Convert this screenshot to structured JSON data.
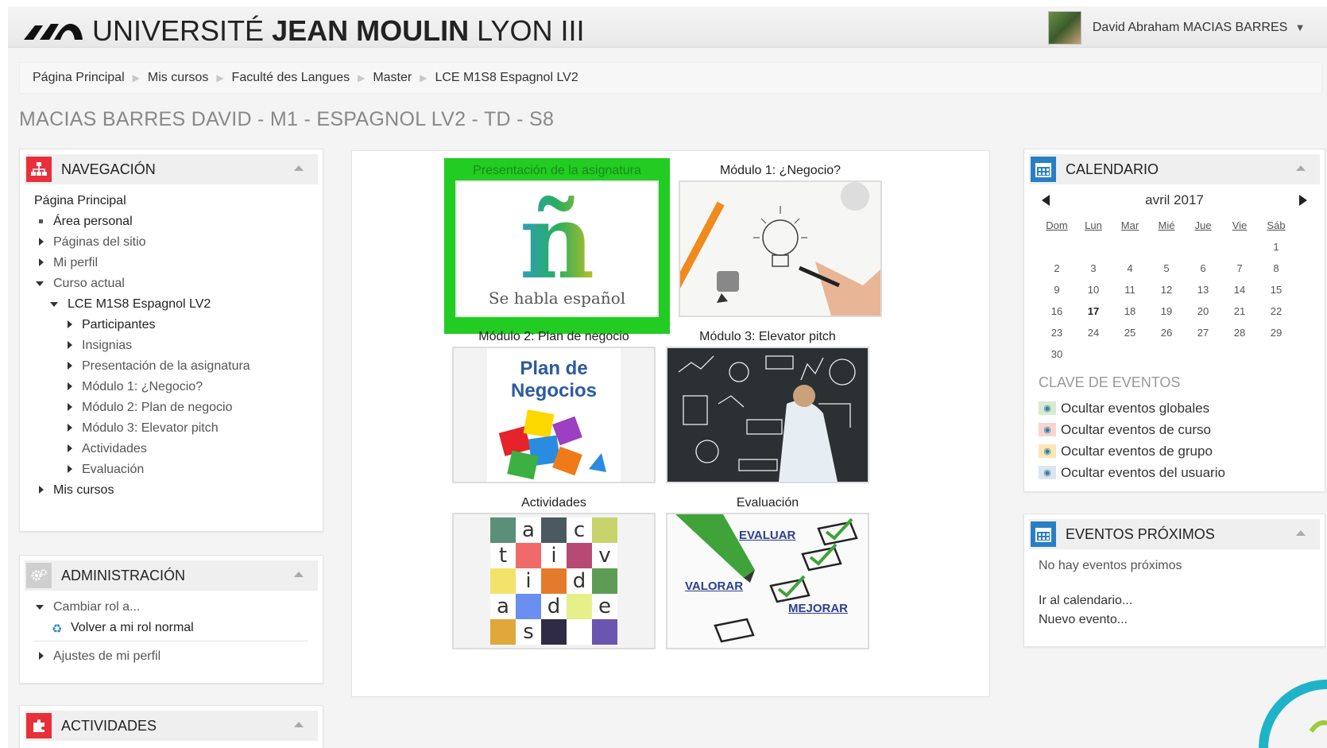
{
  "header": {
    "logo_prefix": "UNIVERSITÉ",
    "logo_bold": "JEAN MOULIN",
    "logo_suffix": "LYON III",
    "user_name": "David Abraham MACIAS BARRES"
  },
  "breadcrumb": [
    "Página Principal",
    "Mis cursos",
    "Faculté des Langues",
    "Master",
    "LCE M1S8 Espagnol LV2"
  ],
  "course_title": "MACIAS BARRES DAVID - M1 - ESPAGNOL LV2 - TD - S8",
  "navigation": {
    "title": "NAVEGACIÓN",
    "root": "Página Principal",
    "area_personal": "Área personal",
    "paginas_sitio": "Páginas del sitio",
    "mi_perfil": "Mi perfil",
    "curso_actual": "Curso actual",
    "course": "LCE M1S8 Espagnol LV2",
    "course_items": [
      "Participantes",
      "Insignias",
      "Presentación de la asignatura",
      "Módulo 1: ¿Negocio?",
      "Módulo 2: Plan de negocio",
      "Módulo 3: Elevator pitch",
      "Actividades",
      "Evaluación"
    ],
    "mis_cursos": "Mis cursos"
  },
  "administration": {
    "title": "ADMINISTRACIÓN",
    "cambiar_rol": "Cambiar rol a...",
    "volver_rol": "Volver a mi rol normal",
    "ajustes": "Ajustes de mi perfil"
  },
  "activities": {
    "title": "ACTIVIDADES"
  },
  "tiles": [
    {
      "label": "Presentación de la asignatura",
      "img_text": "Se habla español",
      "img_letter": "ñ"
    },
    {
      "label": "Módulo 1: ¿Negocio?"
    },
    {
      "label": "Módulo 2: Plan de negocio",
      "img_text": "Plan de Negocios"
    },
    {
      "label": "Módulo 3: Elevator pitch"
    },
    {
      "label": "Actividades",
      "letters": [
        "a",
        "c",
        "t",
        "i",
        "v",
        "i",
        "d",
        "a",
        "d",
        "e",
        "s"
      ]
    },
    {
      "label": "Evaluación",
      "words": [
        "EVALUAR",
        "VALORAR",
        "MEJORAR"
      ]
    }
  ],
  "calendar": {
    "title": "CALENDARIO",
    "month": "avril 2017",
    "day_headers": [
      "Dom",
      "Lun",
      "Mar",
      "Mié",
      "Jue",
      "Vie",
      "Sáb"
    ],
    "weeks": [
      [
        "",
        "",
        "",
        "",
        "",
        "",
        "1"
      ],
      [
        "2",
        "3",
        "4",
        "5",
        "6",
        "7",
        "8"
      ],
      [
        "9",
        "10",
        "11",
        "12",
        "13",
        "14",
        "15"
      ],
      [
        "16",
        "17",
        "18",
        "19",
        "20",
        "21",
        "22"
      ],
      [
        "23",
        "24",
        "25",
        "26",
        "27",
        "28",
        "29"
      ],
      [
        "30",
        "",
        "",
        "",
        "",
        "",
        ""
      ]
    ],
    "key_title": "CLAVE DE EVENTOS",
    "keys": [
      {
        "label": "Ocultar eventos globales",
        "color": "#d6ecd2"
      },
      {
        "label": "Ocultar eventos de curso",
        "color": "#f7d6d0"
      },
      {
        "label": "Ocultar eventos de grupo",
        "color": "#fbe6b8"
      },
      {
        "label": "Ocultar eventos del usuario",
        "color": "#dde6ee"
      }
    ]
  },
  "events": {
    "title": "EVENTOS PRÓXIMOS",
    "none": "No hay eventos próximos",
    "goto_calendar": "Ir al calendario...",
    "new_event": "Nuevo evento..."
  },
  "colors": {
    "nav_icon": "#e8303a",
    "admin_icon": "#c8c8c8",
    "activities_icon": "#e8303a",
    "calendar_icon": "#2a7fc4",
    "selected_tile": "#22cc22"
  }
}
